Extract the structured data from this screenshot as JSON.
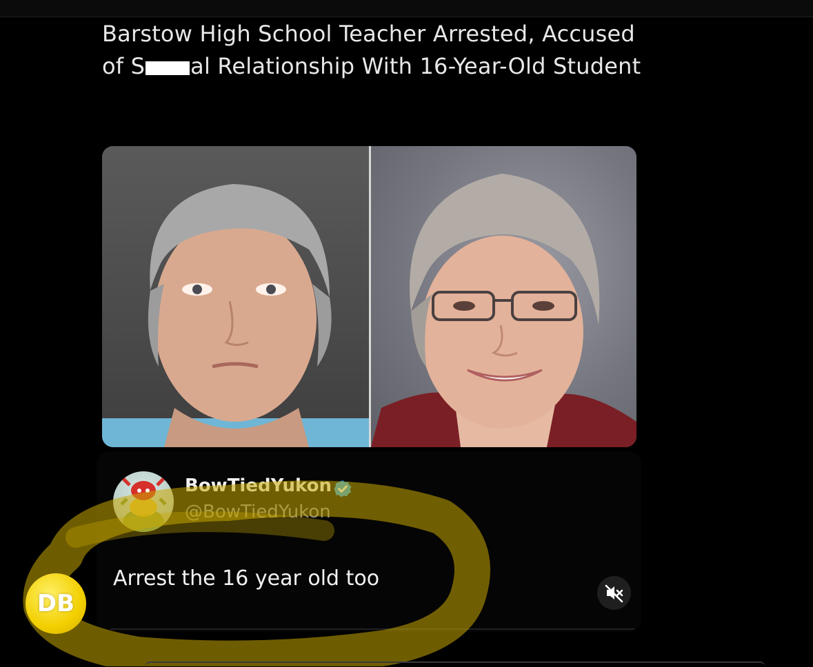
{
  "post": {
    "headline_line1": "Barstow High School Teacher Arrested, Accused",
    "headline_line2_prefix": "of S",
    "headline_line2_suffix": "al Relationship With 16-Year-Old Student"
  },
  "reply": {
    "author_name": "BowTiedYukon",
    "handle": "@BowTiedYukon",
    "text": "Arrest the 16 year old too",
    "verified": true
  },
  "icons": {
    "verified": "verified-badge-icon",
    "mute": "muted-speaker-icon"
  },
  "overlay": {
    "badge_text": "DB",
    "highlight_color": "#c9a800"
  }
}
